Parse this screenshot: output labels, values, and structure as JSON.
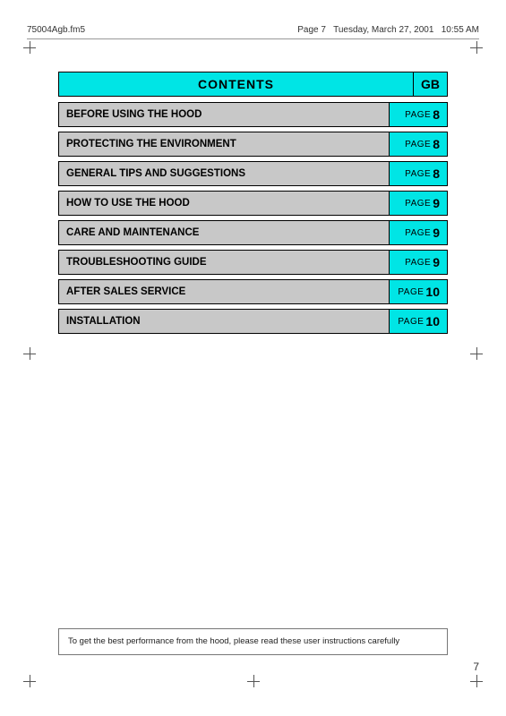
{
  "header": {
    "filename": "75004Agb.fm5",
    "page_info": "Page 7",
    "day": "Tuesday, March 27, 2001",
    "time": "10:55 AM"
  },
  "contents": {
    "title": "CONTENTS",
    "gb_label": "GB",
    "rows": [
      {
        "label": "BEFORE USING THE HOOD",
        "page_word": "PAGE",
        "page_num": "8"
      },
      {
        "label": "PROTECTING THE ENVIRONMENT",
        "page_word": "PAGE",
        "page_num": "8"
      },
      {
        "label": "GENERAL TIPS AND SUGGESTIONS",
        "page_word": "PAGE",
        "page_num": "8"
      },
      {
        "label": "HOW TO USE THE HOOD",
        "page_word": "PAGE",
        "page_num": "9"
      },
      {
        "label": "CARE AND MAINTENANCE",
        "page_word": "PAGE",
        "page_num": "9"
      },
      {
        "label": "TROUBLESHOOTING GUIDE",
        "page_word": "PAGE",
        "page_num": "9"
      },
      {
        "label": "AFTER SALES SERVICE",
        "page_word": "PAGE",
        "page_num": "10"
      },
      {
        "label": "INSTALLATION",
        "page_word": "PAGE",
        "page_num": "10"
      }
    ]
  },
  "footer": {
    "note": "To get the best performance from the hood, please read these user instructions carefully"
  },
  "page_number": "7"
}
